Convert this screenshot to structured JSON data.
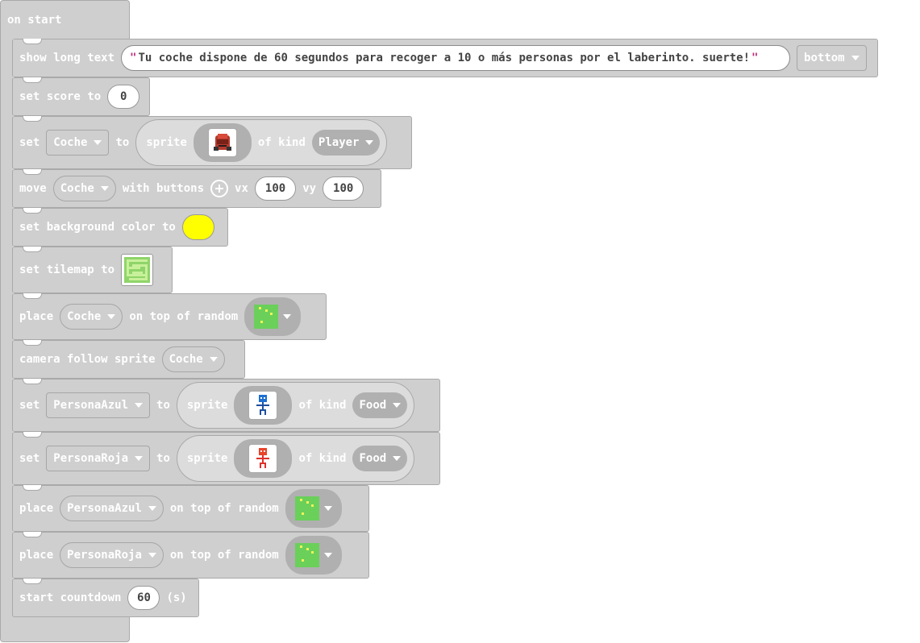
{
  "event": {
    "label": "on start"
  },
  "colors": {
    "background_swatch": "#ffff00"
  },
  "show_long_text": {
    "keyword": "show long text",
    "text": "Tu coche dispone de 60 segundos para recoger a 10 o más personas por el laberinto. suerte!",
    "quote_open": "\"",
    "quote_close": "\"",
    "position": "bottom"
  },
  "set_score": {
    "keyword": "set score to",
    "value": "0"
  },
  "set_coche": {
    "set": "set",
    "var": "Coche",
    "to": "to",
    "sprite": "sprite",
    "of_kind": "of kind",
    "kind": "Player",
    "image_icon": "red-car-icon"
  },
  "move": {
    "keyword": "move",
    "var": "Coche",
    "with_buttons": "with buttons",
    "vx_label": "vx",
    "vx": "100",
    "vy_label": "vy",
    "vy": "100"
  },
  "set_bg": {
    "keyword": "set background color to"
  },
  "set_tilemap": {
    "keyword": "set tilemap to",
    "image_icon": "maze-tilemap-icon"
  },
  "place_coche": {
    "keyword": "place",
    "var": "Coche",
    "on_top": "on top of random",
    "tile_icon": "grass-tile-icon"
  },
  "camera": {
    "keyword": "camera follow sprite",
    "var": "Coche"
  },
  "set_azul": {
    "set": "set",
    "var": "PersonaAzul",
    "to": "to",
    "sprite": "sprite",
    "of_kind": "of kind",
    "kind": "Food",
    "image_icon": "blue-person-icon"
  },
  "set_roja": {
    "set": "set",
    "var": "PersonaRoja",
    "to": "to",
    "sprite": "sprite",
    "of_kind": "of kind",
    "kind": "Food",
    "image_icon": "red-person-icon"
  },
  "place_azul": {
    "keyword": "place",
    "var": "PersonaAzul",
    "on_top": "on top of random",
    "tile_icon": "grass-tile-icon"
  },
  "place_roja": {
    "keyword": "place",
    "var": "PersonaRoja",
    "on_top": "on top of random",
    "tile_icon": "grass-tile-icon"
  },
  "countdown": {
    "keyword": "start countdown",
    "value": "60",
    "unit": "(s)"
  }
}
